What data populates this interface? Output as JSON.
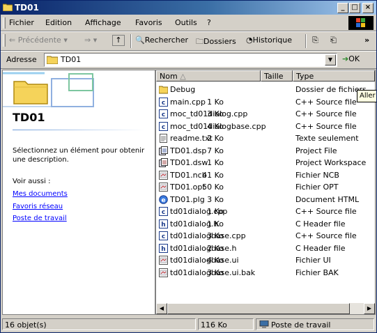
{
  "window": {
    "title": "TD01"
  },
  "menu": [
    "Fichier",
    "Edition",
    "Affichage",
    "Favoris",
    "Outils",
    "?"
  ],
  "toolbar": {
    "back": "Précédente",
    "search": "Rechercher",
    "folders": "Dossiers",
    "history": "Historique",
    "more": "»"
  },
  "address": {
    "label": "Adresse",
    "value": "TD01",
    "go": "OK"
  },
  "left_panel": {
    "folder_title": "TD01",
    "description": "Sélectionnez un élément pour obtenir une description.",
    "see_also": "Voir aussi :",
    "links": [
      "Mes documents",
      "Favoris réseau",
      "Poste de travail"
    ]
  },
  "columns": {
    "name": "Nom",
    "size": "Taille",
    "type": "Type"
  },
  "tooltip": "Aller à",
  "files": [
    {
      "name": "Debug",
      "size": "",
      "type": "Dossier de fichiers",
      "icon": "folder-icon"
    },
    {
      "name": "main.cpp",
      "size": "1 Ko",
      "type": "C++ Source file",
      "icon": "cpp-file-icon"
    },
    {
      "name": "moc_td01dialog.cpp",
      "size": "3 Ko",
      "type": "C++ Source file",
      "icon": "cpp-file-icon"
    },
    {
      "name": "moc_td01dialogbase.cpp",
      "size": "4 Ko",
      "type": "C++ Source file",
      "icon": "cpp-file-icon"
    },
    {
      "name": "readme.txt",
      "size": "2 Ko",
      "type": "Texte seulement",
      "icon": "text-file-icon"
    },
    {
      "name": "TD01.dsp",
      "size": "7 Ko",
      "type": "Project File",
      "icon": "project-file-icon"
    },
    {
      "name": "TD01.dsw",
      "size": "1 Ko",
      "type": "Project Workspace",
      "icon": "workspace-file-icon"
    },
    {
      "name": "TD01.ncb",
      "size": "41 Ko",
      "type": "Fichier NCB",
      "icon": "generic-file-icon"
    },
    {
      "name": "TD01.opt",
      "size": "50 Ko",
      "type": "Fichier OPT",
      "icon": "generic-file-icon"
    },
    {
      "name": "TD01.plg",
      "size": "3 Ko",
      "type": "Document HTML",
      "icon": "html-file-icon"
    },
    {
      "name": "td01dialog.cpp",
      "size": "1 Ko",
      "type": "C++ Source file",
      "icon": "cpp-file-icon"
    },
    {
      "name": "td01dialog.h",
      "size": "1 Ko",
      "type": "C Header file",
      "icon": "header-file-icon"
    },
    {
      "name": "td01dialogbase.cpp",
      "size": "3 Ko",
      "type": "C++ Source file",
      "icon": "cpp-file-icon"
    },
    {
      "name": "td01dialogbase.h",
      "size": "2 Ko",
      "type": "C Header file",
      "icon": "header-file-icon"
    },
    {
      "name": "td01dialogbase.ui",
      "size": "4 Ko",
      "type": "Fichier UI",
      "icon": "generic-file-icon"
    },
    {
      "name": "td01dialogbase.ui.bak",
      "size": "3 Ko",
      "type": "Fichier BAK",
      "icon": "generic-file-icon"
    }
  ],
  "status": {
    "count": "16 objet(s)",
    "size": "116 Ko",
    "location": "Poste de travail"
  }
}
